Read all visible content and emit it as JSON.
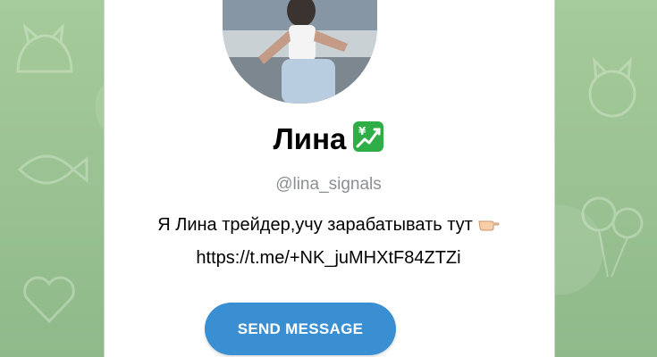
{
  "profile": {
    "name": "Лина",
    "username": "@lina_signals",
    "bio_line1": "Я Лина трейдер,учу зарабатывать тут",
    "bio_line2": "https://t.me/+NK_juMHXtF84ZTZi",
    "verified_emoji_icon": "chart-yen-icon",
    "pointer_icon": "pointing-finger-icon"
  },
  "actions": {
    "send_message_label": "SEND MESSAGE"
  },
  "colors": {
    "background": "#9fc496",
    "button": "#3a8fd3",
    "username": "#8a8f93"
  }
}
